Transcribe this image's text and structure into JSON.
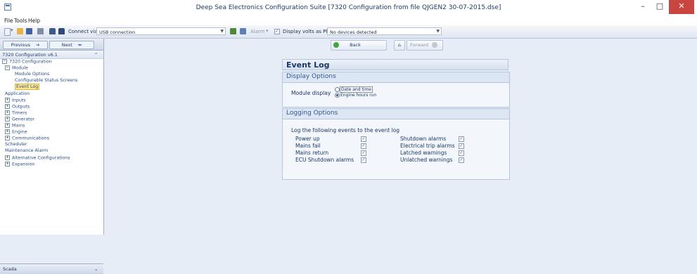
{
  "window": {
    "title": "Deep Sea Electronics Configuration Suite [7320 Configuration from file QJGEN2 30-07-2015.dse]",
    "minimize": "–",
    "maximize": "□",
    "close": "✕"
  },
  "menu": {
    "items": [
      "File",
      "Tools",
      "Help"
    ]
  },
  "toolbar": {
    "connect_label": "Connect via",
    "connection_value": "USB connection",
    "alarm_label": "Alarm",
    "display_volts_label": "Display volts as PhPh",
    "devices_value": "No devices detected"
  },
  "sidebar": {
    "previous": "Previous",
    "next": "Next",
    "header": "7320 Configuration v6.1",
    "tree": [
      {
        "label": "7320 Configuration",
        "expander": "⊟",
        "indent": 0
      },
      {
        "label": "Module",
        "expander": "⊟",
        "indent": 1
      },
      {
        "label": "Module Options",
        "expander": "",
        "indent": 2
      },
      {
        "label": "Configurable Status Screens",
        "expander": "",
        "indent": 2
      },
      {
        "label": "Event Log",
        "expander": "",
        "indent": 2,
        "selected": true
      },
      {
        "label": "Application",
        "expander": "",
        "indent": 1
      },
      {
        "label": "Inputs",
        "expander": "⊞",
        "indent": 1
      },
      {
        "label": "Outputs",
        "expander": "⊞",
        "indent": 1
      },
      {
        "label": "Timers",
        "expander": "⊞",
        "indent": 1
      },
      {
        "label": "Generator",
        "expander": "⊞",
        "indent": 1
      },
      {
        "label": "Mains",
        "expander": "⊞",
        "indent": 1
      },
      {
        "label": "Engine",
        "expander": "⊞",
        "indent": 1
      },
      {
        "label": "Communications",
        "expander": "⊞",
        "indent": 1
      },
      {
        "label": "Scheduler",
        "expander": "",
        "indent": 1
      },
      {
        "label": "Maintenance Alarm",
        "expander": "",
        "indent": 1
      },
      {
        "label": "Alternative Configurations",
        "expander": "⊞",
        "indent": 1
      },
      {
        "label": "Expansion",
        "expander": "⊞",
        "indent": 1
      }
    ],
    "footer": "Scada"
  },
  "nav": {
    "back": "Back",
    "forward": "Forward"
  },
  "event_log": {
    "title": "Event Log",
    "display_options": {
      "title": "Display Options",
      "module_display_label": "Module display",
      "options": [
        "Date and time",
        "Engine hours run"
      ],
      "selected": "Engine hours run"
    },
    "logging_options": {
      "title": "Logging Options",
      "intro": "Log the following events to the event log",
      "left": [
        {
          "label": "Power up",
          "checked": true
        },
        {
          "label": "Mains fail",
          "checked": true
        },
        {
          "label": "Mains return",
          "checked": true
        },
        {
          "label": "ECU Shutdown alarms",
          "checked": true
        }
      ],
      "right": [
        {
          "label": "Shutdown alarms",
          "checked": true
        },
        {
          "label": "Electrical trip alarms",
          "checked": true
        },
        {
          "label": "Latched warnings",
          "checked": true
        },
        {
          "label": "Unlatched warnings",
          "checked": true
        }
      ]
    }
  }
}
